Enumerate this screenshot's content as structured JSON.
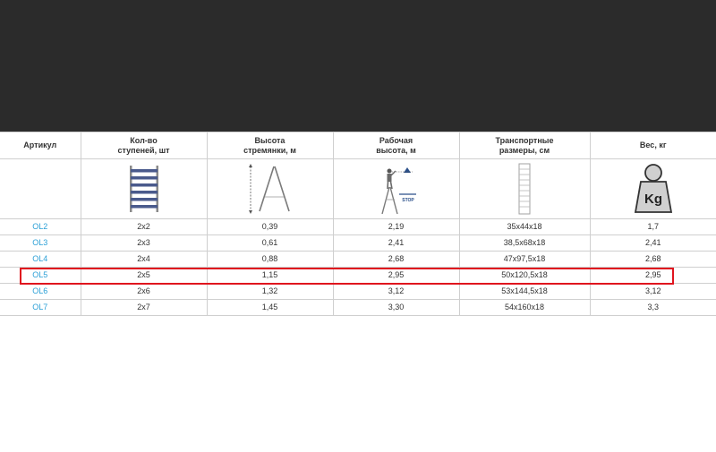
{
  "table": {
    "headers": [
      "Артикул",
      "Кол-во\nступеней, шт",
      "Высота\nстремянки, м",
      "Рабочая\nвысота, м",
      "Транспортные\nразмеры, см",
      "Вес, кг"
    ],
    "icons": {
      "steps": "ladder-steps-icon",
      "height": "stepladder-height-icon",
      "work": "worker-on-ladder-icon",
      "transport": "folded-ladder-icon",
      "weight": "weight-kg-icon",
      "stop_label": "STOP",
      "kg_label": "Kg"
    },
    "rows": [
      [
        "OL2",
        "2x2",
        "0,39",
        "2,19",
        "35x44x18",
        "1,7"
      ],
      [
        "OL3",
        "2x3",
        "0,61",
        "2,41",
        "38,5x68x18",
        "2,41"
      ],
      [
        "OL4",
        "2x4",
        "0,88",
        "2,68",
        "47x97,5x18",
        "2,68"
      ],
      [
        "OL5",
        "2x5",
        "1,15",
        "2,95",
        "50x120,5x18",
        "2,95"
      ],
      [
        "OL6",
        "2x6",
        "1,32",
        "3,12",
        "53x144,5x18",
        "3,12"
      ],
      [
        "OL7",
        "2x7",
        "1,45",
        "3,30",
        "54x160x18",
        "3,3"
      ]
    ],
    "highlighted_row": 3
  },
  "colors": {
    "top_band": "#2b2b2b",
    "link": "#2a9fd6",
    "highlight": "#e0141e",
    "ladder_steps": "#4a5a8c"
  }
}
